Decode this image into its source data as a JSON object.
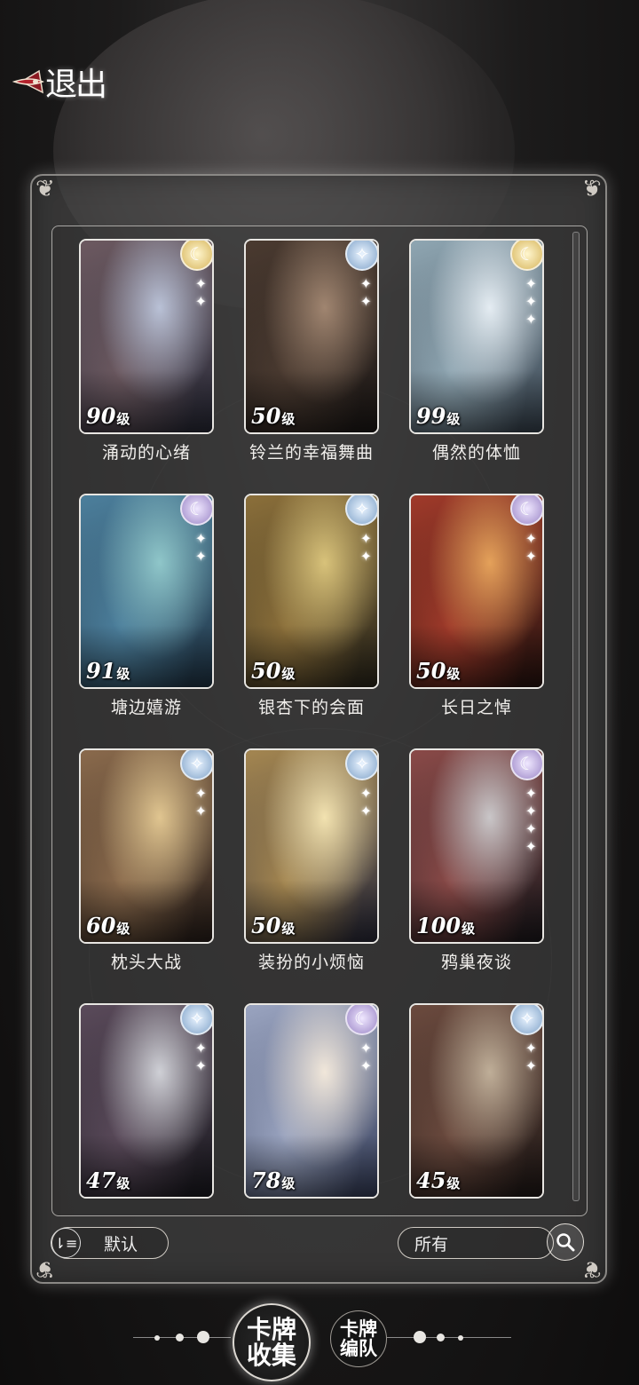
{
  "header": {
    "exit_label": "退出"
  },
  "cards": [
    {
      "title": "涌动的心绪",
      "level": "90",
      "level_unit": "级",
      "rarity": "gold",
      "sparkles": 2,
      "palette": [
        "#b9c1d6",
        "#6c5960",
        "#2b2c3a"
      ]
    },
    {
      "title": "铃兰的幸福舞曲",
      "level": "50",
      "level_unit": "级",
      "rarity": "blue",
      "sparkles": 2,
      "palette": [
        "#a08570",
        "#4a3a30",
        "#1f1a18"
      ]
    },
    {
      "title": "偶然的体恤",
      "level": "99",
      "level_unit": "级",
      "rarity": "gold",
      "sparkles": 3,
      "palette": [
        "#e4ecf2",
        "#8fa6b2",
        "#3b4753"
      ]
    },
    {
      "title": "塘边嬉游",
      "level": "91",
      "level_unit": "级",
      "rarity": "purple",
      "sparkles": 2,
      "palette": [
        "#8fc6c9",
        "#4c7f9c",
        "#22384a"
      ]
    },
    {
      "title": "银杏下的会面",
      "level": "50",
      "level_unit": "级",
      "rarity": "blue",
      "sparkles": 2,
      "palette": [
        "#d8c27a",
        "#8b6f3a",
        "#2f2a1d"
      ]
    },
    {
      "title": "长日之悼",
      "level": "50",
      "level_unit": "级",
      "rarity": "purple",
      "sparkles": 2,
      "palette": [
        "#e4a15a",
        "#a03a2a",
        "#2a1410"
      ]
    },
    {
      "title": "枕头大战",
      "level": "60",
      "level_unit": "级",
      "rarity": "blue",
      "sparkles": 2,
      "palette": [
        "#e0c590",
        "#8a6a4c",
        "#2c211c"
      ]
    },
    {
      "title": "装扮的小烦恼",
      "level": "50",
      "level_unit": "级",
      "rarity": "blue",
      "sparkles": 2,
      "palette": [
        "#f2e2b0",
        "#a48650",
        "#2c2c3c"
      ]
    },
    {
      "title": "鸦巢夜谈",
      "level": "100",
      "level_unit": "级",
      "rarity": "purple",
      "sparkles": 4,
      "palette": [
        "#c9c6c8",
        "#8a4a48",
        "#1e1a1e"
      ]
    },
    {
      "title": "",
      "level": "47",
      "level_unit": "级",
      "rarity": "blue",
      "sparkles": 2,
      "palette": [
        "#cfd0d6",
        "#5a4a5a",
        "#1c1b22"
      ]
    },
    {
      "title": "",
      "level": "78",
      "level_unit": "级",
      "rarity": "purple",
      "sparkles": 2,
      "palette": [
        "#f1e7da",
        "#9aa4c0",
        "#3a4360"
      ]
    },
    {
      "title": "",
      "level": "45",
      "level_unit": "级",
      "rarity": "blue",
      "sparkles": 2,
      "palette": [
        "#bfae98",
        "#6b4a3e",
        "#221a18"
      ]
    }
  ],
  "controls": {
    "sort_label": "默认",
    "sort_icon": "sort-list-icon",
    "filter_label": "所有",
    "search_icon": "search-icon"
  },
  "tabs": [
    {
      "label_line1": "卡牌",
      "label_line2": "收集",
      "active": true
    },
    {
      "label_line1": "卡牌",
      "label_line2": "编队",
      "active": false
    }
  ]
}
